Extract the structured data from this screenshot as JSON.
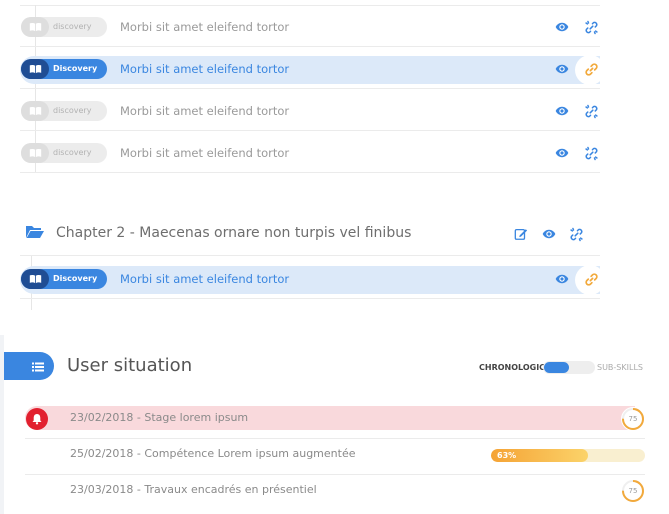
{
  "lessons_top": [
    {
      "badge": "discovery",
      "title": "Morbi sit amet eleifend tortor",
      "active": false,
      "linked": false
    },
    {
      "badge": "Discovery",
      "title": "Morbi sit amet eleifend tortor",
      "active": true,
      "linked": true
    },
    {
      "badge": "discovery",
      "title": "Morbi sit amet eleifend tortor",
      "active": false,
      "linked": false
    },
    {
      "badge": "discovery",
      "title": "Morbi sit amet eleifend tortor",
      "active": false,
      "linked": false
    }
  ],
  "chapter": {
    "title": "Chapter 2 - Maecenas ornare non turpis vel finibus",
    "lessons": [
      {
        "badge": "Discovery",
        "title": "Morbi sit amet eleifend tortor",
        "active": true,
        "linked": true
      }
    ]
  },
  "user_situation": {
    "title": "User situation",
    "toggle": {
      "left_label": "CHRONOLOGIC",
      "right_label": "SUB-SKILLS",
      "selected": "CHRONOLOGIC"
    },
    "rows": [
      {
        "text": "23/02/2018 - Stage lorem ipsum",
        "alert": true,
        "score": "75",
        "score_fraction": 0.75
      },
      {
        "text": "25/02/2018 - Compétence Lorem ipsum augmentée",
        "alert": false,
        "progress": 0.63,
        "progress_label": "63%"
      },
      {
        "text": "23/03/2018 - Travaux encadrés en présentiel",
        "alert": false,
        "score": "75",
        "score_fraction": 0.75
      }
    ]
  },
  "colors": {
    "accent": "#3a86e0",
    "link_active": "#f2a93b",
    "alert": "#e2202f",
    "alert_bg": "#f9d9dc",
    "highlight_bg": "#dce9f9"
  },
  "icons": {
    "badge": "book-open-icon",
    "view": "eye-icon",
    "linked": "link-icon",
    "unlinked": "broken-link-icon",
    "chapter": "folder-open-icon",
    "edit": "edit-icon",
    "section": "list-icon",
    "alert": "bell-icon"
  }
}
